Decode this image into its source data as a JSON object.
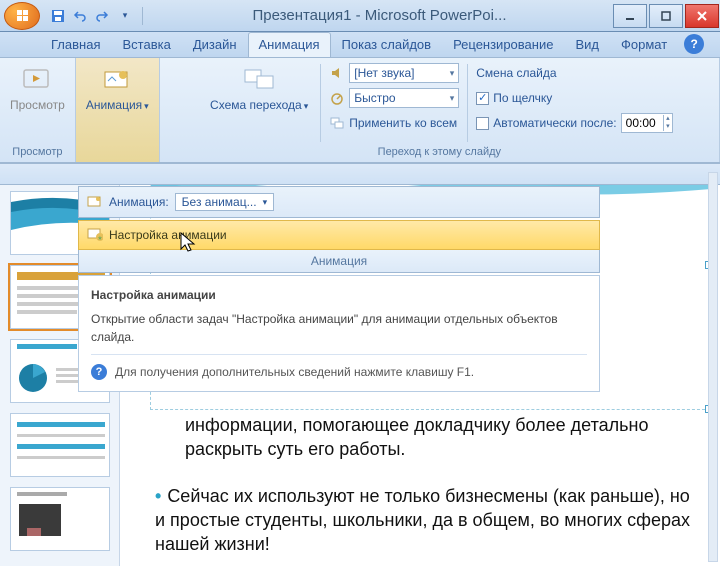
{
  "title": "Презентация1 - Microsoft PowerPoi...",
  "tabs": {
    "home": "Главная",
    "insert": "Вставка",
    "design": "Дизайн",
    "anim": "Анимация",
    "slideshow": "Показ слайдов",
    "review": "Рецензирование",
    "view": "Вид",
    "format": "Формат"
  },
  "ribbon": {
    "preview_btn": "Просмотр",
    "preview_group": "Просмотр",
    "anim_btn": "Анимация",
    "transition_btn": "Схема перехода",
    "sound_combo": "[Нет звука]",
    "speed_combo": "Быстро",
    "apply_all": "Применить ко всем",
    "advance_lbl": "Смена слайда",
    "on_click": "По щелчку",
    "auto_after": "Автоматически после:",
    "auto_time": "00:00",
    "group_transition": "Переход к этому слайду"
  },
  "dd": {
    "anim_label": "Анимация:",
    "anim_value": "Без анимац...",
    "custom_anim": "Настройка анимации",
    "group": "Анимация",
    "tip_title": "Настройка анимации",
    "tip_body": "Открытие области задач \"Настройка анимации\" для анимации отдельных объектов слайда.",
    "tip_f1": "Для получения дополнительных сведений нажмите клавишу F1."
  },
  "body": {
    "p1": "информации, помогающее докладчику более детально раскрыть суть его работы.",
    "p2": "Сейчас их используют не только бизнесмены (как раньше), но и простые студенты, школьники, да в общем, во многих сферах нашей жизни!"
  }
}
